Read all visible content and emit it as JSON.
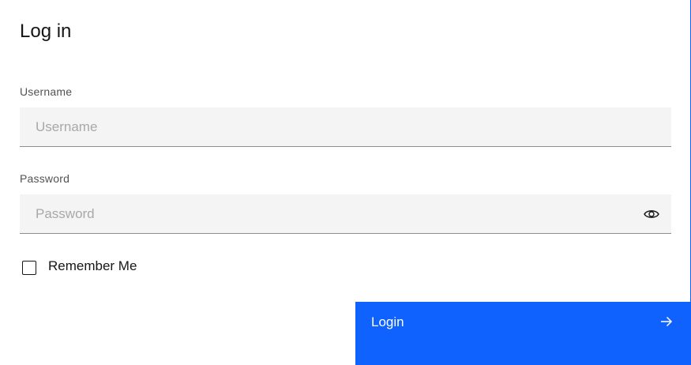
{
  "form": {
    "title": "Log in",
    "username": {
      "label": "Username",
      "placeholder": "Username",
      "value": ""
    },
    "password": {
      "label": "Password",
      "placeholder": "Password",
      "value": "",
      "toggle_icon": "eye-icon"
    },
    "remember": {
      "label": "Remember Me",
      "checked": false
    },
    "submit": {
      "label": "Login",
      "icon": "arrow-right-icon"
    }
  },
  "colors": {
    "primary": "#0f62fe",
    "field_background": "#f4f4f4",
    "text": "#161616",
    "label": "#525252",
    "placeholder": "#a8a8a8"
  }
}
